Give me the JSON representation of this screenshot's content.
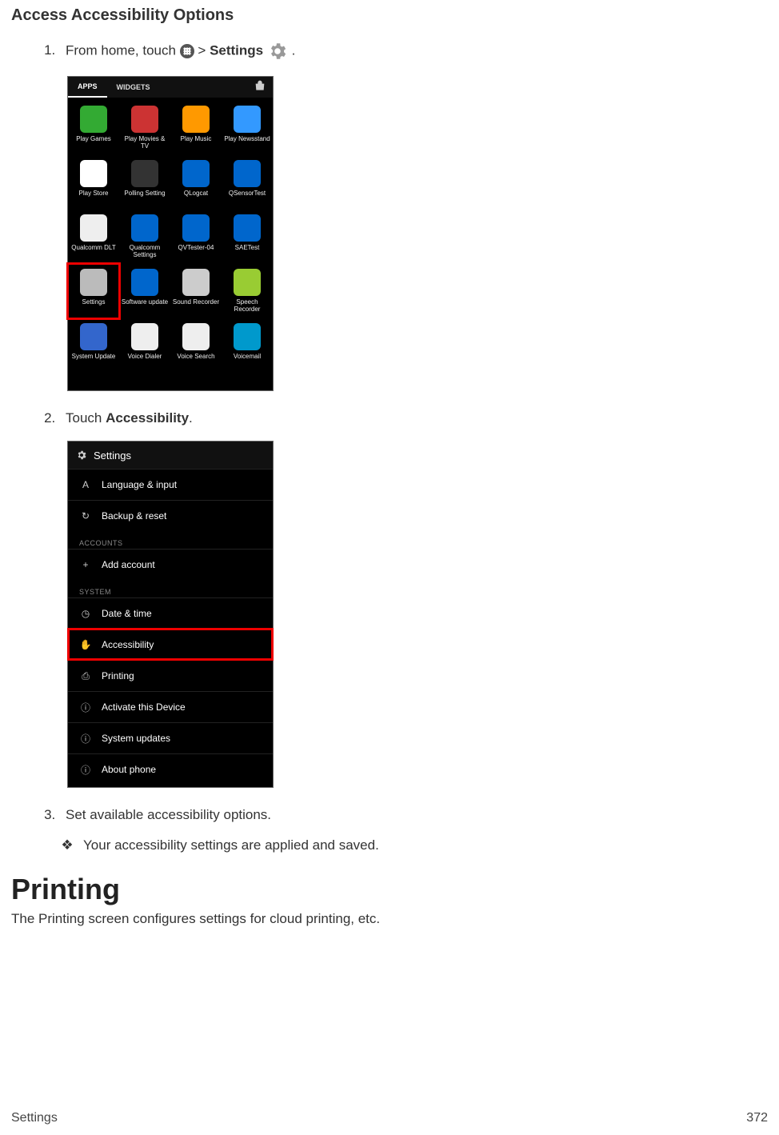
{
  "heading": "Access Accessibility Options",
  "step1": {
    "pre": "From home, touch ",
    "sep": " > ",
    "settings": "Settings",
    "post": "."
  },
  "screenshot1": {
    "tabs": {
      "apps": "APPS",
      "widgets": "WIDGETS"
    },
    "apps": [
      {
        "label": "Play Games",
        "color": "#3a3"
      },
      {
        "label": "Play Movies & TV",
        "color": "#c33"
      },
      {
        "label": "Play Music",
        "color": "#f90"
      },
      {
        "label": "Play Newsstand",
        "color": "#39f"
      },
      {
        "label": "Play Store",
        "color": "#fff"
      },
      {
        "label": "Polling Setting",
        "color": "#333"
      },
      {
        "label": "QLogcat",
        "color": "#06c"
      },
      {
        "label": "QSensorTest",
        "color": "#06c"
      },
      {
        "label": "Qualcomm DLT",
        "color": "#eee"
      },
      {
        "label": "Qualcomm Settings",
        "color": "#06c"
      },
      {
        "label": "QVTester-04",
        "color": "#06c"
      },
      {
        "label": "SAETest",
        "color": "#06c"
      },
      {
        "label": "Settings",
        "color": "#bbb",
        "hl": true
      },
      {
        "label": "Software update",
        "color": "#06c"
      },
      {
        "label": "Sound Recorder",
        "color": "#ccc"
      },
      {
        "label": "Speech Recorder",
        "color": "#9c3"
      },
      {
        "label": "System Update",
        "color": "#36c"
      },
      {
        "label": "Voice Dialer",
        "color": "#eee"
      },
      {
        "label": "Voice Search",
        "color": "#eee"
      },
      {
        "label": "Voicemail",
        "color": "#09c"
      }
    ]
  },
  "step2": {
    "pre": "Touch ",
    "bold": "Accessibility",
    "post": "."
  },
  "screenshot2": {
    "title": "Settings",
    "rows": [
      {
        "icon": "A",
        "label": "Language & input"
      },
      {
        "icon": "↻",
        "label": "Backup & reset"
      }
    ],
    "hdr1": "ACCOUNTS",
    "addAccount": {
      "icon": "+",
      "label": "Add account"
    },
    "hdr2": "SYSTEM",
    "sysrows": [
      {
        "icon": "◷",
        "label": "Date & time"
      },
      {
        "icon": "✋",
        "label": "Accessibility",
        "hl": true
      },
      {
        "icon": "⎙",
        "label": "Printing"
      },
      {
        "icon": "ⓘ",
        "label": "Activate this Device"
      },
      {
        "icon": "ⓘ",
        "label": "System updates"
      },
      {
        "icon": "ⓘ",
        "label": "About phone"
      }
    ]
  },
  "step3": "Set available accessibility options.",
  "result": "Your accessibility settings are applied and saved.",
  "h1": "Printing",
  "h1_sub": "The Printing screen configures settings for cloud printing, etc.",
  "footer": {
    "left": "Settings",
    "right": "372"
  }
}
